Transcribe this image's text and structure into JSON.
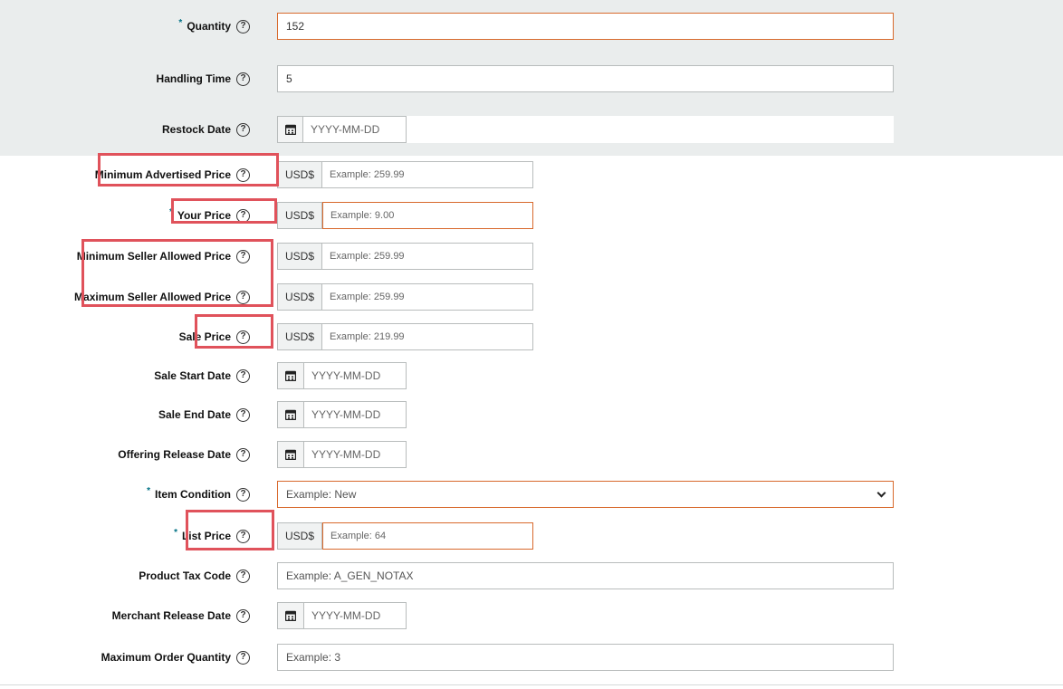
{
  "fields": {
    "quantity": {
      "label": "Quantity",
      "required": "*",
      "value": "152"
    },
    "handling_time": {
      "label": "Handling Time",
      "value": "5"
    },
    "restock_date": {
      "label": "Restock Date",
      "placeholder": "YYYY-MM-DD"
    },
    "min_advertised_price": {
      "label": "Minimum Advertised Price",
      "currency": "USD$",
      "placeholder": "Example: 259.99"
    },
    "your_price": {
      "label": "Your Price",
      "required": "*",
      "currency": "USD$",
      "placeholder": "Example: 9.00"
    },
    "min_seller_allowed_price": {
      "label": "Minimum Seller Allowed Price",
      "currency": "USD$",
      "placeholder": "Example: 259.99"
    },
    "max_seller_allowed_price": {
      "label": "Maximum Seller Allowed Price",
      "currency": "USD$",
      "placeholder": "Example: 259.99"
    },
    "sale_price": {
      "label": "Sale Price",
      "currency": "USD$",
      "placeholder": "Example: 219.99"
    },
    "sale_start_date": {
      "label": "Sale Start Date",
      "placeholder": "YYYY-MM-DD"
    },
    "sale_end_date": {
      "label": "Sale End Date",
      "placeholder": "YYYY-MM-DD"
    },
    "offering_release_date": {
      "label": "Offering Release Date",
      "placeholder": "YYYY-MM-DD"
    },
    "item_condition": {
      "label": "Item Condition",
      "required": "*",
      "placeholder": "Example: New"
    },
    "list_price": {
      "label": "List Price",
      "required": "*",
      "currency": "USD$",
      "placeholder": "Example: 64"
    },
    "product_tax_code": {
      "label": "Product Tax Code",
      "placeholder": "Example: A_GEN_NOTAX"
    },
    "merchant_release_date": {
      "label": "Merchant Release Date",
      "placeholder": "YYYY-MM-DD"
    },
    "max_order_quantity": {
      "label": "Maximum Order Quantity",
      "placeholder": "Example: 3"
    }
  },
  "help_glyph": "?",
  "colors": {
    "required_asterisk": "#007185",
    "error_border": "#d8692c",
    "highlight_box": "#e0525b",
    "gray_band": "#eaeded"
  }
}
